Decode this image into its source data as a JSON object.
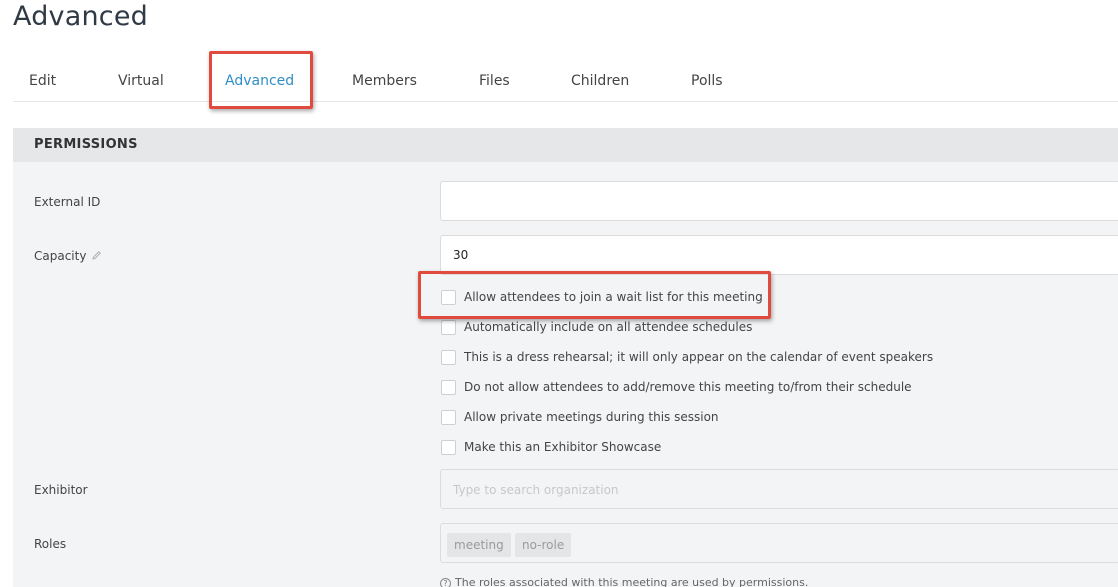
{
  "page": {
    "title": "Advanced"
  },
  "tabs": [
    {
      "label": "Edit"
    },
    {
      "label": "Virtual"
    },
    {
      "label": "Advanced",
      "active": true
    },
    {
      "label": "Members"
    },
    {
      "label": "Files"
    },
    {
      "label": "Children"
    },
    {
      "label": "Polls"
    }
  ],
  "permissions": {
    "header": "PERMISSIONS",
    "external_id": {
      "label": "External ID",
      "value": ""
    },
    "capacity": {
      "label": "Capacity",
      "value": "30",
      "icon": "pencil-icon"
    },
    "checkboxes": [
      {
        "label": "Allow attendees to join a wait list for this meeting",
        "checked": false
      },
      {
        "label": "Automatically include on all attendee schedules",
        "checked": false
      },
      {
        "label": "This is a dress rehearsal; it will only appear on the calendar of event speakers",
        "checked": false
      },
      {
        "label": "Do not allow attendees to add/remove this meeting to/from their schedule",
        "checked": false
      },
      {
        "label": "Allow private meetings during this session",
        "checked": false
      },
      {
        "label": "Make this an Exhibitor Showcase",
        "checked": false
      }
    ],
    "exhibitor": {
      "label": "Exhibitor",
      "placeholder": "Type to search organization"
    },
    "roles": {
      "label": "Roles",
      "chips": [
        "meeting",
        "no-role"
      ],
      "help_text": "The roles associated with this meeting are used by permissions."
    }
  },
  "colors": {
    "accent": "#2f8ec6",
    "highlight": "#e04b3d",
    "panel": "#f3f4f6",
    "panel_header": "#e6e7e9"
  }
}
